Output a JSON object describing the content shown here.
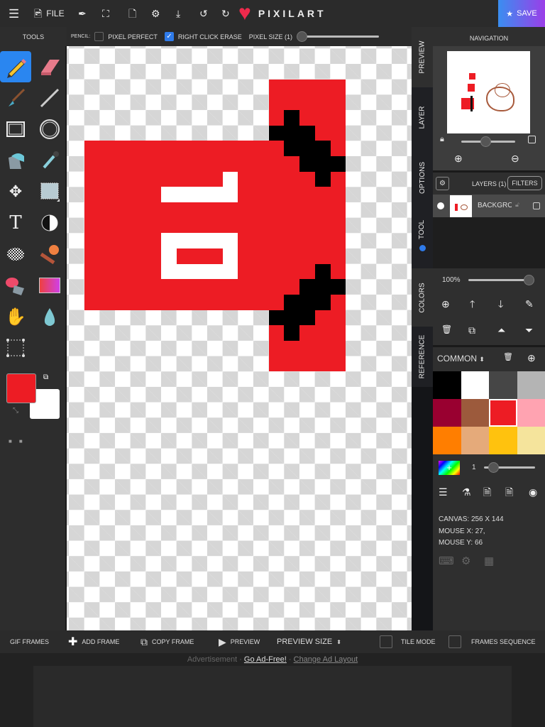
{
  "topbar": {
    "file_label": "FILE",
    "logo": "PIXILART",
    "save_label": "SAVE",
    "icons": [
      "menu-icon",
      "file-image-icon",
      "eyedropper-icon",
      "resize-icon",
      "new-file-icon",
      "settings-icon",
      "download-icon",
      "undo-icon",
      "redo-icon",
      "heart-logo-icon",
      "star-icon"
    ]
  },
  "options": {
    "pencil_label": "PENCIL:",
    "pixel_perfect": "PIXEL PERFECT",
    "pixel_perfect_checked": false,
    "right_click_erase": "RIGHT CLICK ERASE",
    "right_click_erase_checked": true,
    "pixel_size_label": "PIXEL SIZE (1)",
    "pixel_size": 1
  },
  "tools": {
    "header": "TOOLS",
    "primary_color": "#ed1c24",
    "secondary_color": "#ffffff",
    "items": [
      "pencil",
      "eraser",
      "brush",
      "line",
      "rectangle",
      "ellipse",
      "fill-bucket",
      "eyedropper",
      "move",
      "select",
      "text",
      "lighten",
      "dither",
      "stamp",
      "paint-roller",
      "gradient",
      "hand",
      "drop",
      "selection-box"
    ]
  },
  "vtabs": [
    "PREVIEW",
    "LAYER",
    "OPTIONS",
    "TOOL",
    "COLORS",
    "REFERENCE"
  ],
  "navigation": {
    "title": "NAVIGATION"
  },
  "layers": {
    "title": "LAYERS (1)",
    "filters": "FILTERS",
    "items": [
      {
        "name": "BACKGRO"
      }
    ],
    "opacity": "100%"
  },
  "palette": {
    "name": "COMMON",
    "colors": [
      "#000000",
      "#ffffff",
      "#464646",
      "#b4b4b4",
      "#990030",
      "#9c5a3c",
      "#ed1c24",
      "#ffa3b1",
      "#ff7e00",
      "#e5aa7a",
      "#ffc20e",
      "#f5e49c"
    ],
    "selected": 6
  },
  "brush_size": "1",
  "info": {
    "canvas": "CANVAS: 256 X 144",
    "mouse_x": "MOUSE X: 27,",
    "mouse_y": "MOUSE Y: 66"
  },
  "bottom": {
    "gif_frames": "GIF FRAMES",
    "add_frame": "ADD FRAME",
    "copy_frame": "COPY FRAME",
    "preview": "PREVIEW",
    "preview_size": "PREVIEW SIZE",
    "tile_mode": "TILE MODE",
    "frames_sequence": "FRAMES SEQUENCE"
  },
  "ad": {
    "label": "Advertisement ·",
    "go_ad_free": "Go Ad-Free!",
    "sep": " · ",
    "change_layout": "Change Ad Layout"
  }
}
